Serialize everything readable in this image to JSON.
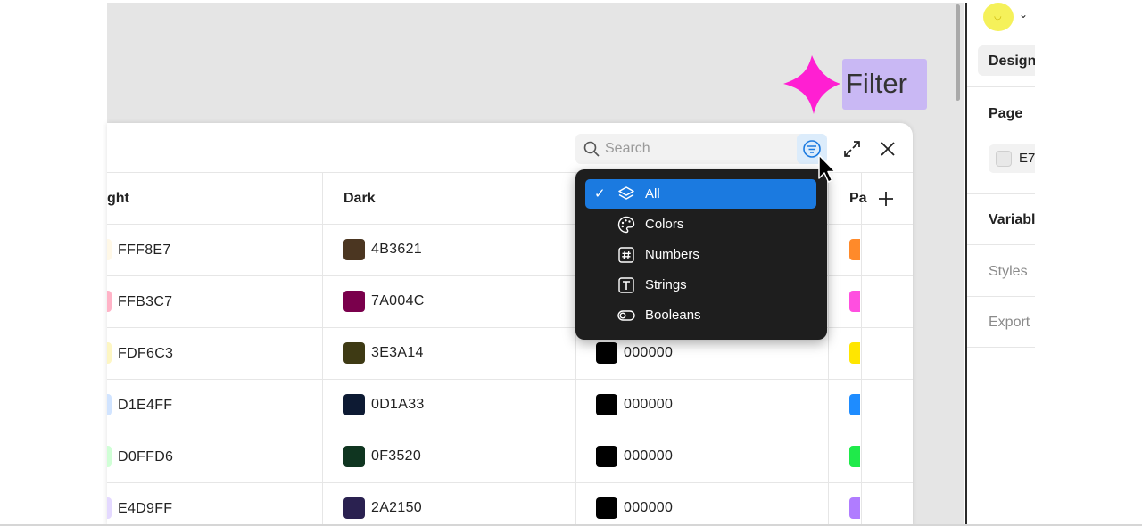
{
  "annotation": {
    "label": "Filter",
    "color": "#c9b8f4",
    "marker_color": "#ff1fd2"
  },
  "right_panel": {
    "design_tab": "Design",
    "page_label": "Page",
    "page_value": "E7",
    "variables_label": "Variabl",
    "styles_label": "Styles",
    "export_label": "Export"
  },
  "toolbar": {
    "search_placeholder": "Search",
    "filter_icon": "filter-icon",
    "expand_icon": "expand-icon",
    "close_icon": "close-icon"
  },
  "table": {
    "headers": [
      "ght",
      "Dark",
      "",
      "Pa"
    ],
    "add_column_icon": "plus-icon",
    "rows": [
      {
        "light": {
          "hex": "FFF8E7",
          "color": "#FFF8E7"
        },
        "dark": {
          "hex": "4B3621",
          "color": "#4B3621"
        },
        "third": {
          "hex": "",
          "color": ""
        },
        "partial_color": "#FF8A2A"
      },
      {
        "light": {
          "hex": "FFB3C7",
          "color": "#FFB3C7"
        },
        "dark": {
          "hex": "7A004C",
          "color": "#7A004C"
        },
        "third": {
          "hex": "",
          "color": ""
        },
        "partial_color": "#FF4FE0"
      },
      {
        "light": {
          "hex": "FDF6C3",
          "color": "#FDF6C3"
        },
        "dark": {
          "hex": "3E3A14",
          "color": "#3E3A14"
        },
        "third": {
          "hex": "000000",
          "color": "#000000"
        },
        "partial_color": "#FFE600"
      },
      {
        "light": {
          "hex": "D1E4FF",
          "color": "#D1E4FF"
        },
        "dark": {
          "hex": "0D1A33",
          "color": "#0D1A33"
        },
        "third": {
          "hex": "000000",
          "color": "#000000"
        },
        "partial_color": "#1E8CFF"
      },
      {
        "light": {
          "hex": "D0FFD6",
          "color": "#D0FFD6"
        },
        "dark": {
          "hex": "0F3520",
          "color": "#0F3520"
        },
        "third": {
          "hex": "000000",
          "color": "#000000"
        },
        "partial_color": "#1FEA4A"
      },
      {
        "light": {
          "hex": "E4D9FF",
          "color": "#E4D9FF"
        },
        "dark": {
          "hex": "2A2150",
          "color": "#2A2150"
        },
        "third": {
          "hex": "000000",
          "color": "#000000"
        },
        "partial_color": "#B07CFF"
      }
    ]
  },
  "filter_menu": {
    "items": [
      {
        "label": "All",
        "icon": "layers-icon",
        "selected": true
      },
      {
        "label": "Colors",
        "icon": "palette-icon",
        "selected": false
      },
      {
        "label": "Numbers",
        "icon": "hash-icon",
        "selected": false
      },
      {
        "label": "Strings",
        "icon": "text-icon",
        "selected": false
      },
      {
        "label": "Booleans",
        "icon": "toggle-icon",
        "selected": false
      }
    ],
    "check_mark": "✓",
    "accent": "#1b7ae0"
  }
}
